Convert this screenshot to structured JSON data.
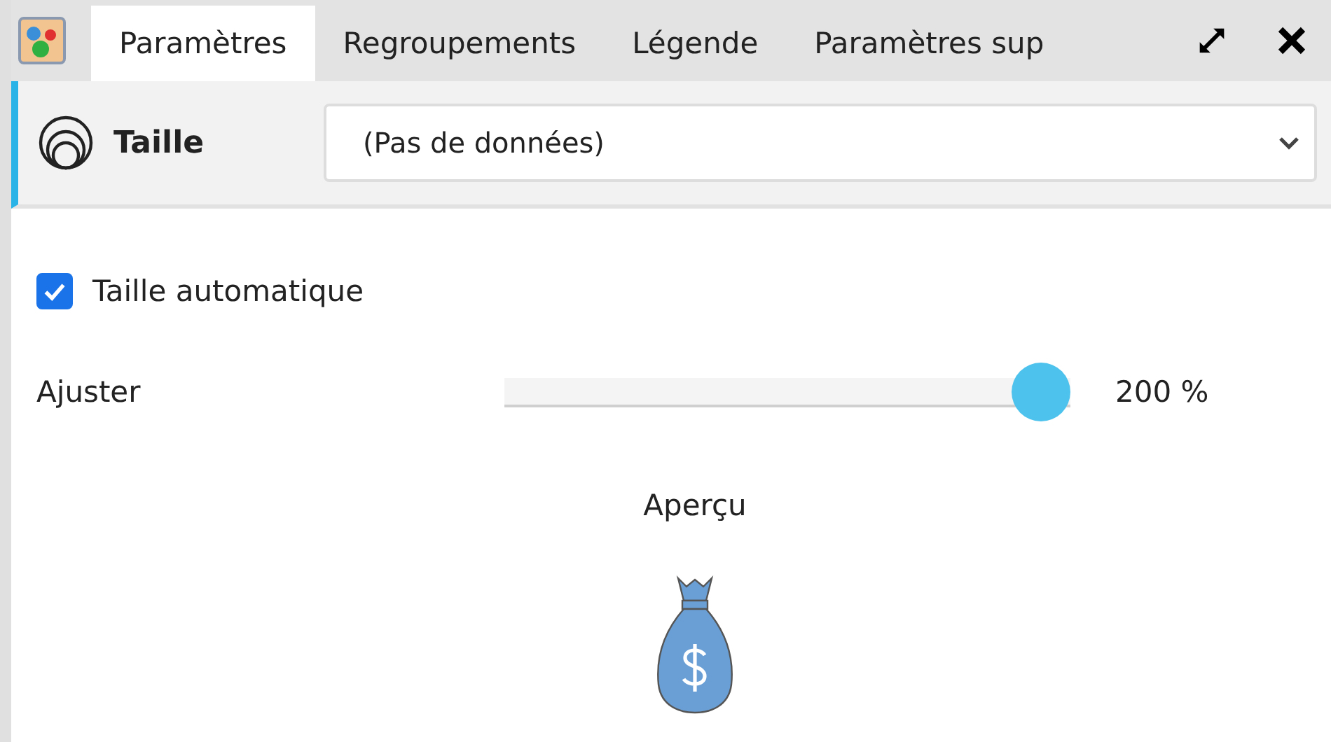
{
  "tabs": [
    {
      "label": "Paramètres",
      "selected": true
    },
    {
      "label": "Regroupements",
      "selected": false
    },
    {
      "label": "Légende",
      "selected": false
    },
    {
      "label": "Paramètres sup",
      "selected": false
    }
  ],
  "header": {
    "title": "Taille",
    "dropdown": {
      "value": "(Pas de données)"
    }
  },
  "auto_size": {
    "label": "Taille automatique",
    "checked": true
  },
  "adjust": {
    "label": "Ajuster",
    "level": 1,
    "reading": "200 %"
  },
  "preview": {
    "label": "Aperçu"
  }
}
